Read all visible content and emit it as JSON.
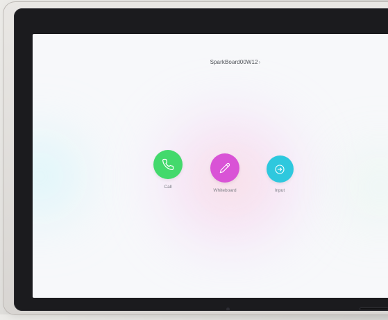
{
  "device": {
    "name": "SparkBoard00W12"
  },
  "actions": [
    {
      "label": "Call",
      "icon": "phone-icon",
      "color": "#43d96c"
    },
    {
      "label": "Whiteboard",
      "icon": "pencil-icon",
      "color": "#d953d6"
    },
    {
      "label": "Input",
      "icon": "arrow-right-icon",
      "color": "#2ec8de"
    }
  ],
  "colors": {
    "background": "#f7f8fa",
    "bezel": "#1b1b1e",
    "text": "#4d5056",
    "secondary_text": "#7a7d84",
    "chevron": "#8e9199"
  },
  "decorative": {
    "title_chevron": "›"
  }
}
